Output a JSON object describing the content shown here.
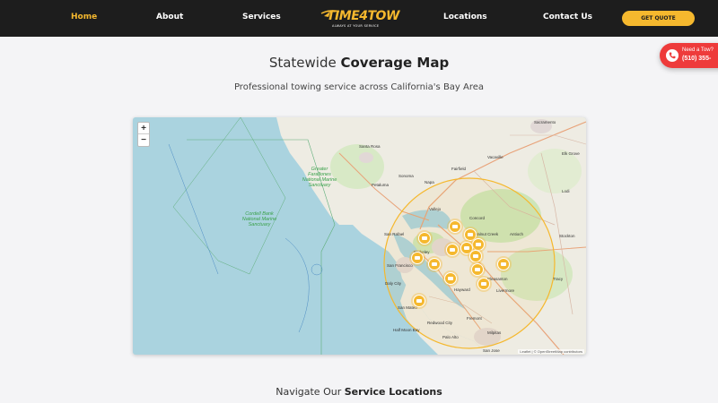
{
  "nav": {
    "items": [
      {
        "label": "Home",
        "active": true
      },
      {
        "label": "About"
      },
      {
        "label": "Services"
      },
      {
        "label": "Locations"
      },
      {
        "label": "Contact Us"
      }
    ],
    "logo_text": "TIME4TOW",
    "logo_tagline": "ALWAYS AT YOUR SERVICE",
    "cta_label": "GET QUOTE"
  },
  "call_tab": {
    "label": "Need a Tow?",
    "phone": "(510) 355-"
  },
  "coverage": {
    "title_plain": "Statewide ",
    "title_bold": "Coverage Map",
    "subtitle": "Professional towing service across California's Bay Area"
  },
  "map": {
    "zoom_in": "+",
    "zoom_out": "−",
    "attribution": "Leaflet | © OpenStreetMap contributors",
    "water_labels": [
      "Greater Farallones National Marine Sanctuary",
      "Cordell Bank National Marine Sanctuary"
    ],
    "places": [
      "Sacramento",
      "Santa Rosa",
      "Petaluma",
      "Sonoma",
      "Napa",
      "Vallejo",
      "San Rafael",
      "Berkeley",
      "San Francisco",
      "Daly City",
      "San Mateo",
      "Redwood City",
      "Hayward",
      "Livermore",
      "Fremont",
      "San Jose",
      "Elk Grove",
      "Fairfield",
      "Vacaville",
      "Lodi",
      "Stockton",
      "Tracy",
      "Walnut Creek",
      "Concord",
      "Antioch",
      "Half Moon Bay",
      "Palo Alto",
      "Milpitas",
      "Pleasanton"
    ],
    "accent_color": "#f5b82e",
    "marker_count": 14
  },
  "next_section": {
    "title_plain": "Navigate Our ",
    "title_bold": "Service Locations"
  }
}
